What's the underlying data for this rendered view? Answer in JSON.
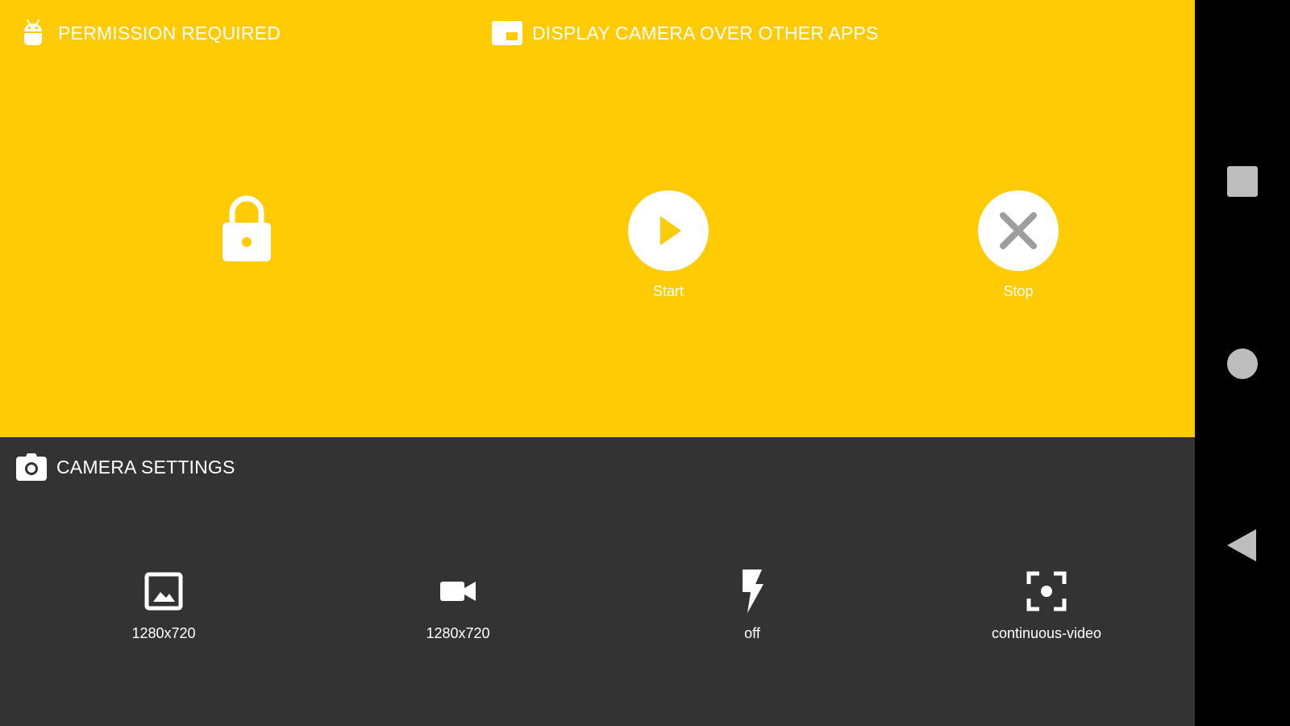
{
  "header": {
    "permission_label": "PERMISSION REQUIRED",
    "overlay_label": "DISPLAY CAMERA OVER OTHER APPS"
  },
  "controls": {
    "start_label": "Start",
    "stop_label": "Stop"
  },
  "camera_settings": {
    "title": "CAMERA SETTINGS",
    "items": [
      {
        "icon": "image-icon",
        "value": "1280x720"
      },
      {
        "icon": "videocam-icon",
        "value": "1280x720"
      },
      {
        "icon": "flash-icon",
        "value": "off"
      },
      {
        "icon": "focus-icon",
        "value": "continuous-video"
      }
    ]
  },
  "colors": {
    "accent": "#FFCB05",
    "panel_dark": "#333333",
    "nav_bar": "#000000",
    "icon": "#FFFFFF",
    "stop_x": "#9E9E9E"
  }
}
